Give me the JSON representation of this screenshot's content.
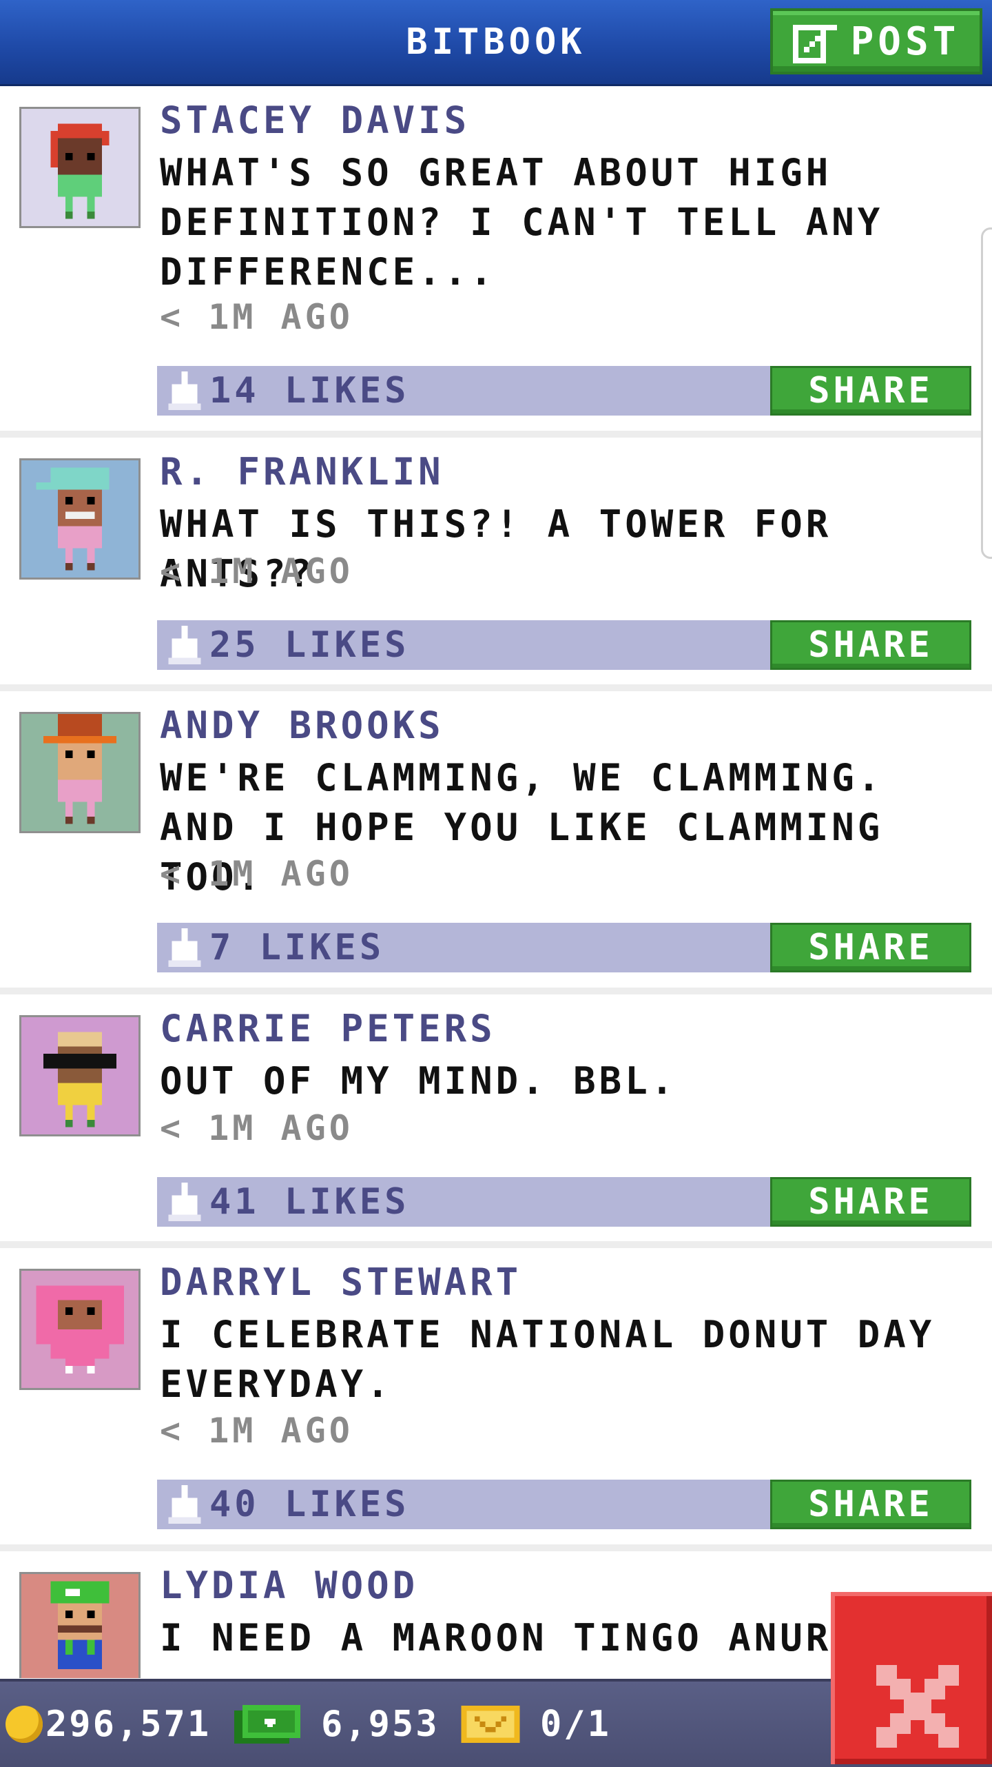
{
  "header": {
    "title": "BITBOOK",
    "post_label": "POST",
    "post_icon": "edit-icon"
  },
  "posts": [
    {
      "author": "STACEY DAVIS",
      "text": "WHAT'S SO GREAT ABOUT HIGH DEFINITION? I CAN'T TELL ANY DIFFERENCE...",
      "time": "< 1M AGO",
      "likes": "14 LIKES",
      "share": "SHARE",
      "avatar_bg": "#dcd8ec"
    },
    {
      "author": "R. FRANKLIN",
      "text": "WHAT IS THIS?! A TOWER FOR ANTS??",
      "time": "< 1M AGO",
      "likes": "25 LIKES",
      "share": "SHARE",
      "avatar_bg": "#8fb4d6"
    },
    {
      "author": "ANDY BROOKS",
      "text": "WE'RE CLAMMING, WE CLAMMING. AND I HOPE YOU LIKE CLAMMING TOO.",
      "time": "< 1M AGO",
      "likes": "7 LIKES",
      "share": "SHARE",
      "avatar_bg": "#8fb7a0"
    },
    {
      "author": "CARRIE PETERS",
      "text": "OUT OF MY MIND. BBL.",
      "time": "< 1M AGO",
      "likes": "41 LIKES",
      "share": "SHARE",
      "avatar_bg": "#cf9ad0"
    },
    {
      "author": "DARRYL STEWART",
      "text": "I CELEBRATE NATIONAL DONUT DAY EVERYDAY.",
      "time": "< 1M AGO",
      "likes": "40 LIKES",
      "share": "SHARE",
      "avatar_bg": "#d79ac5"
    },
    {
      "author": "LYDIA WOOD",
      "text": "I NEED A MAROON TINGO ANURA,",
      "avatar_bg": "#d88a82"
    }
  ],
  "bottom": {
    "coins": "296,571",
    "bux": "6,953",
    "tickets": "0/1",
    "coin_icon": "coin-icon",
    "bux_icon": "bux-icon",
    "ticket_icon": "ticket-icon"
  },
  "colors": {
    "header_blue": "#2f63c8",
    "button_green": "#3fa63a",
    "likes_bar": "#b4b6d8",
    "author_text": "#4a4a85",
    "close_red": "#e33030"
  }
}
